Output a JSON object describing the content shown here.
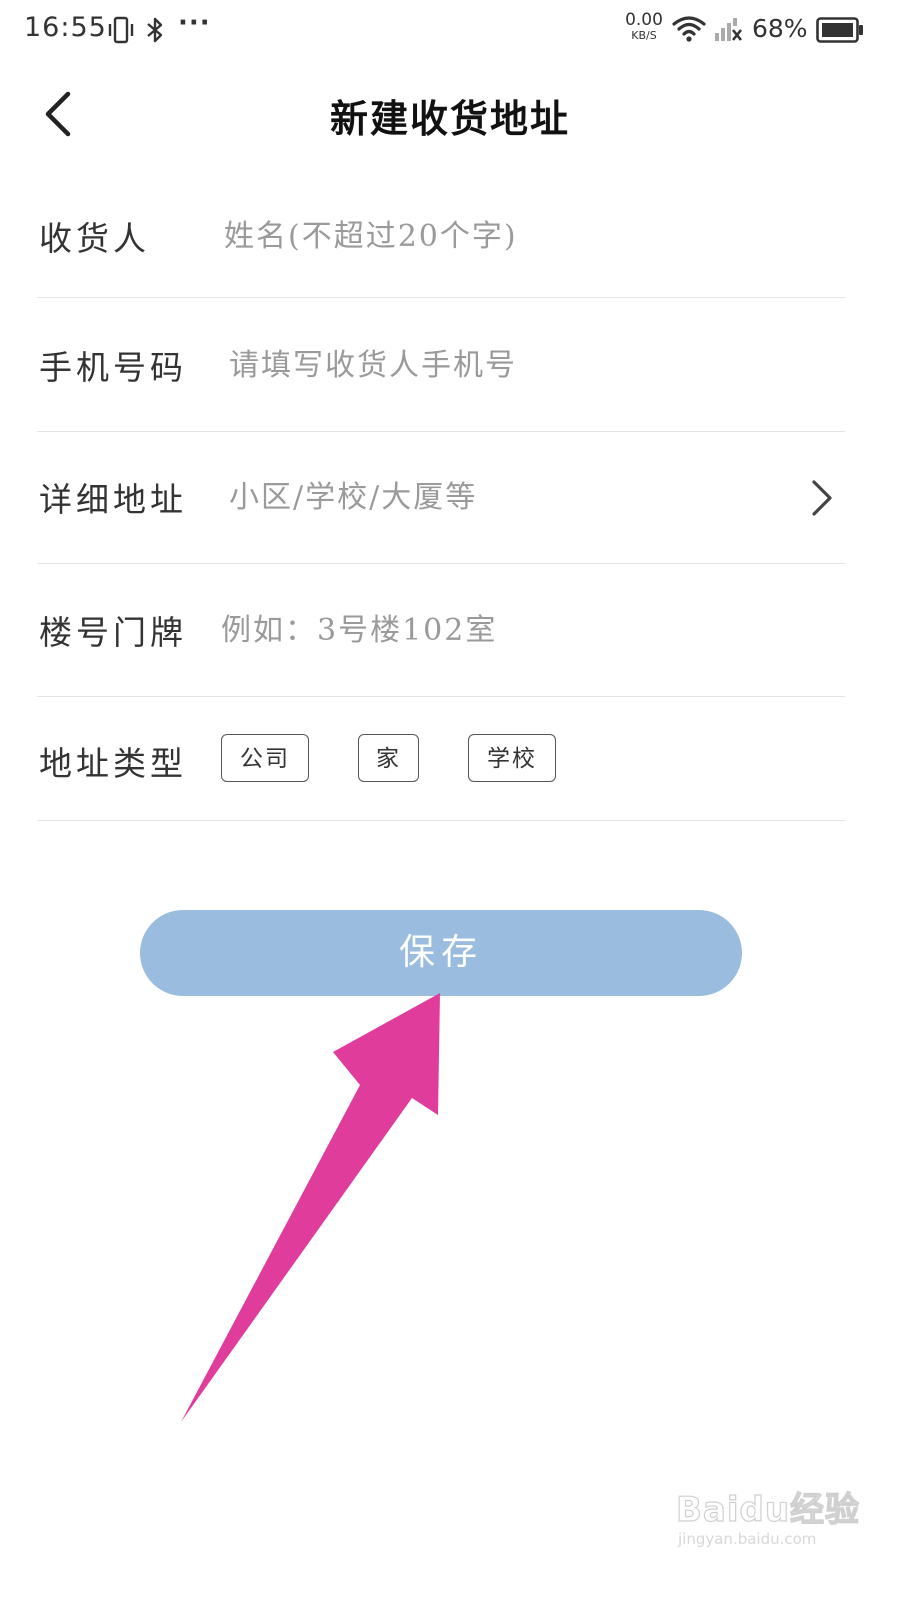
{
  "status_bar": {
    "time": "16:55",
    "more": "···",
    "net_speed_value": "0.00",
    "net_speed_unit": "KB/S",
    "battery_percent": "68%",
    "icons": [
      "vibrate-icon",
      "bluetooth-icon",
      "wifi-icon",
      "signal-icon",
      "battery-icon"
    ]
  },
  "header": {
    "title": "新建收货地址",
    "back_icon": "chevron-left-icon"
  },
  "form": {
    "name": {
      "label": "收货人",
      "value": "",
      "placeholder": "姓名(不超过20个字)"
    },
    "phone": {
      "label": "手机号码",
      "value": "",
      "placeholder": "请填写收货人手机号"
    },
    "address": {
      "label": "详细地址",
      "value": "",
      "placeholder": "小区/学校/大厦等",
      "icon": "chevron-right-icon"
    },
    "door": {
      "label": "楼号门牌",
      "value": "",
      "placeholder": "例如：3号楼102室"
    },
    "address_type": {
      "label": "地址类型",
      "options": [
        "公司",
        "家",
        "学校"
      ]
    }
  },
  "save_button": {
    "label": "保存"
  },
  "colors": {
    "save_button_bg": "#99bcdf",
    "annotation_arrow": "#e03c9b",
    "divider": "#e4e4e4",
    "placeholder": "#9a9a9a"
  },
  "watermark": {
    "logo_text": "Baidu经验",
    "url": "jingyan.baidu.com"
  }
}
